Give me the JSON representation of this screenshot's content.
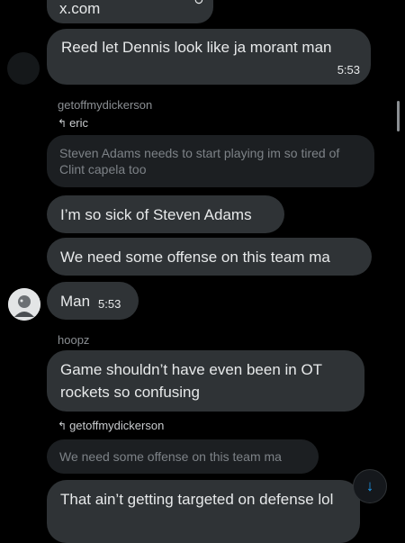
{
  "chat": {
    "link_preview": {
      "domain": "x.com"
    },
    "messages": [
      {
        "text": "Reed let Dennis look like ja morant man",
        "time": "5:53"
      },
      {
        "sender": "getoffmydickerson",
        "reply_to": "eric",
        "quoted": "Steven Adams needs to start playing im so tired of Clint capela too"
      },
      {
        "text": "I’m so sick of Steven Adams"
      },
      {
        "text": "We need some offense on this team ma"
      },
      {
        "text": "Man",
        "time": "5:53"
      },
      {
        "sender": "hoopz",
        "text": "Game shouldn’t have even been in OT rockets so confusing"
      },
      {
        "reply_to": "getoffmydickerson",
        "quoted": "We need some offense on this team ma"
      },
      {
        "text": "That ain’t getting targeted on defense lol"
      }
    ]
  },
  "icons": {
    "reply": "reply-arrow-icon",
    "scroll_down": "arrow-down-icon",
    "link": "link-icon"
  },
  "colors": {
    "background": "#000000",
    "bubble": "#2f3336",
    "accent": "#1d9bf0",
    "muted": "#8b8f93"
  }
}
